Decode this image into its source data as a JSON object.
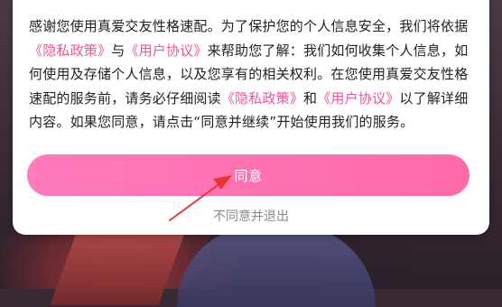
{
  "dialog": {
    "body": {
      "part1": "感谢您使用真爱交友性格速配。为了保护您的个人信息安全，我们将依据",
      "privacy_link_1": "《隐私政策》",
      "and_1": "与",
      "user_agreement_link_1": "《用户协议》",
      "part2": "来帮助您了解：我们如何收集个人信息，如何使用及存储个人信息，以及您享有的相关权利。在您使用真爱交友性格速配的服务前，请务必仔细阅读",
      "privacy_link_2": "《隐私政策》",
      "and_2": "和",
      "user_agreement_link_2": "《用户协议》",
      "part3": "以了解详细内容。如果您同意，请点击“同意并继续”开始使用我们的服务。"
    },
    "agree_button_label": "同意",
    "disagree_label": "不同意并退出"
  },
  "colors": {
    "link": "#f0559a",
    "button": "#ff6aa7",
    "annotation_arrow": "#ee3333"
  }
}
